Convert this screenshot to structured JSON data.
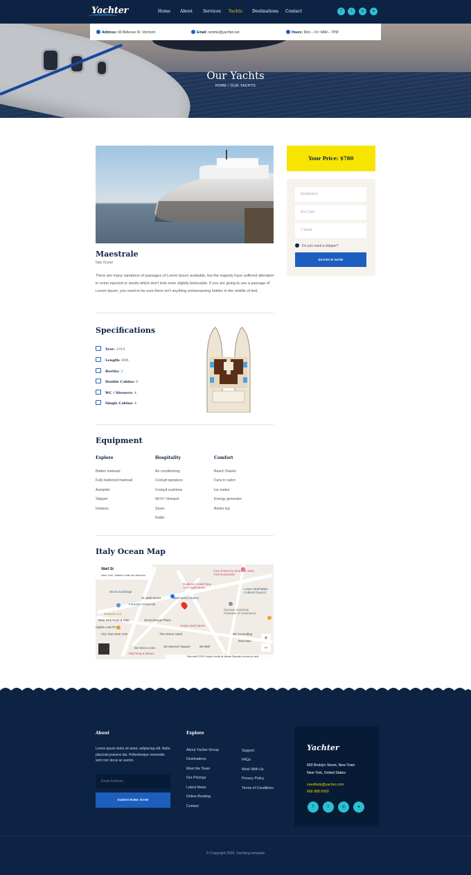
{
  "brand": {
    "logo": "Yachter"
  },
  "nav": {
    "items": [
      "Home",
      "About",
      "Services",
      "Yachts",
      "Destinations",
      "Contact"
    ],
    "active": "Yachts"
  },
  "social": [
    "facebook-icon",
    "twitter-icon",
    "instagram-icon",
    "tripadvisor-icon"
  ],
  "infobar": {
    "address_label": "Address:",
    "address": "66 Bellevue Dr, Vermont",
    "email_label": "Email:",
    "email": "rentme@yachter.net",
    "hours_label": "Hours:",
    "hours": "Mon – Fri: 9AM – 7PM"
  },
  "hero": {
    "title": "Our Yachts",
    "breadcrumb": "HOME / OUR YACHTS"
  },
  "yacht": {
    "name": "Maestrale",
    "location": "Italy Ocean",
    "description": "There are many variations of passages of Lorem Ipsum available, but the majority have suffered alteration in some injected or words which don't look even slightly believable. If you are going to use a passage of Lorem Ipsum, you need to be sure there isn't anything embarrassing hidden in the middle of text."
  },
  "specs": {
    "title": "Specifications",
    "items": [
      {
        "label": "Year:",
        "value": "2019",
        "icon": "calendar-icon"
      },
      {
        "label": "Length:",
        "value": "89ft.",
        "icon": "ruler-icon"
      },
      {
        "label": "Berths:",
        "value": "2",
        "icon": "anchor-icon"
      },
      {
        "label": "Double Cabins:",
        "value": "8",
        "icon": "user-icon"
      },
      {
        "label": "WC / Showers:",
        "value": "4",
        "icon": "shower-icon"
      },
      {
        "label": "Single Cabins:",
        "value": "4",
        "icon": "boat-icon"
      }
    ]
  },
  "equipment": {
    "title": "Equipment",
    "columns": [
      {
        "heading": "Explore",
        "items": [
          "Batten mainsail",
          "Fully battened mainsail",
          "Autopilot",
          "Skipper",
          "Hostess"
        ]
      },
      {
        "heading": "Hospitality",
        "items": [
          "Air conditioning",
          "Cockpit speakers",
          "Cockpit cushions",
          "Wi-Fi / Hotspot",
          "Stove",
          "Radio"
        ]
      },
      {
        "heading": "Comfort",
        "items": [
          "Beach Towels",
          "Fans in salon",
          "Ice maker",
          "Energy generator",
          "Bimini top"
        ]
      }
    ]
  },
  "map": {
    "title": "Italy Ocean Map",
    "place": "Wall St",
    "place_sub": "New York, Statele Unite ale Americii",
    "labels": [
      "Stock Exchange",
      "Foresters Financial",
      "Wall Street Station",
      "Radisson Hotel New York Wall Street",
      "Four Points by Sheraton New York Downtown",
      "Lower Manhattan Cultural Council",
      "German American Chamber of Commerce",
      "Reserve Cut",
      "New York Pack & Ship",
      "City Year New York",
      "Andaz Wall Street",
      "The Grace Hotel",
      "40 Exchange Place",
      "Ogden Law PLLC",
      "10 Hanover Square",
      "95 Wall",
      "IIB Consulting",
      "New Mac",
      "Mad Dog & Beans",
      "De Gecco USA",
      "31 Wall Street"
    ],
    "footer": "Date hartă ©2020 Google   Condiții de utilizare   Raportați o eroare pe hartă"
  },
  "booking": {
    "price_label": "Your Price: $780",
    "destination_placeholder": "Destination",
    "date_placeholder": "Any Date",
    "week_placeholder": "1 Week",
    "skipper_label": "Do you need a skipper?",
    "search_label": "SEARCH NOW"
  },
  "footer": {
    "about_title": "About",
    "about_text": "Lorem ipsum dolor sit amet, adipiscing elit. Nulla placerat posuere dui. Pellentesque venenatis sem non lacus ac auctor.",
    "email_placeholder": "Email Address",
    "subscribe_label": "SUBSCRIBE NOW",
    "explore_title": "Explore",
    "explore_col1": [
      "About Yacher Group",
      "Destinations",
      "Meet the Team",
      "Our Pricings",
      "Latest News",
      "Online Booking",
      "Contact"
    ],
    "explore_col2": [
      "Support",
      "FAQs",
      "Work With Us",
      "Privacy Policy",
      "Terms of Conditions"
    ],
    "card_logo": "Yachter",
    "address1": "660 Broklyn Street, New Town",
    "address2": "New York, United States",
    "email": "needhelp@yacher.com",
    "phone": "666 888 0000",
    "copyright": "© Copyright 2020. Yachting template"
  },
  "colors": {
    "navy": "#0d2344",
    "accent_yellow": "#f7e400",
    "button_blue": "#1d5fbf",
    "social_cyan": "#2bc0d2"
  }
}
